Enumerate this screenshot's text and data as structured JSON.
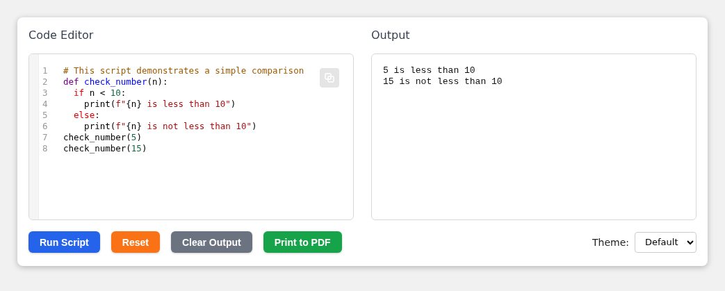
{
  "editor": {
    "title": "Code Editor",
    "lines": [
      {
        "number": "1",
        "tokens": [
          {
            "kind": "comment",
            "text": "# This script demonstrates a simple comparison"
          }
        ]
      },
      {
        "number": "2",
        "tokens": [
          {
            "kind": "keyword",
            "text": "def "
          },
          {
            "kind": "function",
            "text": "check_number"
          },
          {
            "kind": "plain",
            "text": "(n):"
          }
        ]
      },
      {
        "number": "3",
        "tokens": [
          {
            "kind": "control",
            "text": "  if"
          },
          {
            "kind": "plain",
            "text": " n < "
          },
          {
            "kind": "number",
            "text": "10"
          },
          {
            "kind": "plain",
            "text": ":"
          }
        ]
      },
      {
        "number": "4",
        "tokens": [
          {
            "kind": "plain",
            "text": "    print("
          },
          {
            "kind": "string",
            "text": "f\""
          },
          {
            "kind": "plain",
            "text": "{n}"
          },
          {
            "kind": "string",
            "text": " is less than 10\""
          },
          {
            "kind": "plain",
            "text": ")"
          }
        ]
      },
      {
        "number": "5",
        "tokens": [
          {
            "kind": "control",
            "text": "  else"
          },
          {
            "kind": "plain",
            "text": ":"
          }
        ]
      },
      {
        "number": "6",
        "tokens": [
          {
            "kind": "plain",
            "text": "    print("
          },
          {
            "kind": "string",
            "text": "f\""
          },
          {
            "kind": "plain",
            "text": "{n}"
          },
          {
            "kind": "string",
            "text": " is not less than 10\""
          },
          {
            "kind": "plain",
            "text": ")"
          }
        ]
      },
      {
        "number": "7",
        "tokens": [
          {
            "kind": "plain",
            "text": "check_number("
          },
          {
            "kind": "number",
            "text": "5"
          },
          {
            "kind": "plain",
            "text": ")"
          }
        ]
      },
      {
        "number": "8",
        "tokens": [
          {
            "kind": "plain",
            "text": "check_number("
          },
          {
            "kind": "number",
            "text": "15"
          },
          {
            "kind": "plain",
            "text": ")"
          }
        ]
      }
    ]
  },
  "output": {
    "title": "Output",
    "lines": [
      "5 is less than 10",
      "15 is not less than 10"
    ]
  },
  "buttons": [
    {
      "label": "Run Script",
      "color": "#2563eb"
    },
    {
      "label": "Reset",
      "color": "#f97316"
    },
    {
      "label": "Clear Output",
      "color": "#6b7280"
    },
    {
      "label": "Print to PDF",
      "color": "#16a34a"
    }
  ],
  "theme": {
    "label": "Theme:",
    "value": "Default"
  }
}
